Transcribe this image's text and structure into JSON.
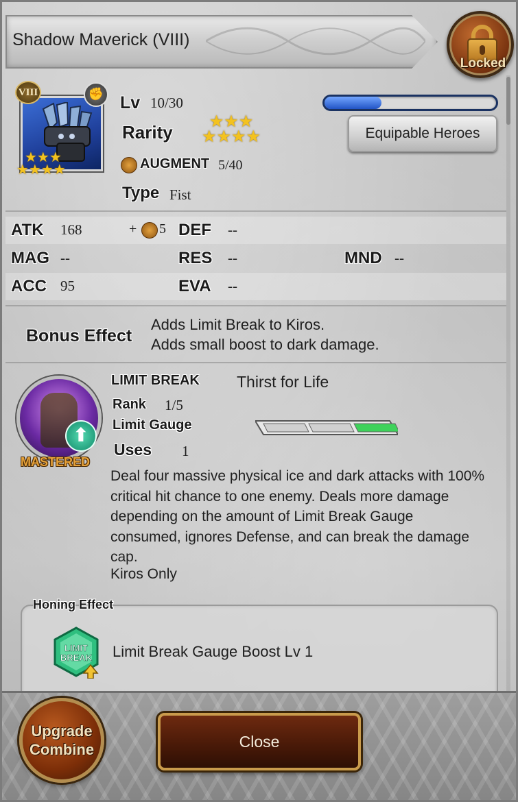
{
  "header": {
    "title": "Shadow Maverick (VIII)"
  },
  "lock": {
    "label": "Locked"
  },
  "item": {
    "series_badge": "VIII",
    "icon_stars": "★★★\n★★★★",
    "level": {
      "label": "Lv",
      "value": "10/30",
      "progress": 0.33
    },
    "rarity": {
      "label": "Rarity",
      "stars_top": "★★★",
      "stars_bottom": "★★★★"
    },
    "equipable_button": "Equipable Heroes",
    "augment": {
      "label": "AUGMENT",
      "value": "5/40"
    },
    "type": {
      "label": "Type",
      "value": "Fist"
    }
  },
  "stats": {
    "atk": {
      "label": "ATK",
      "value": "168",
      "bonus_prefix": "+",
      "bonus": "5"
    },
    "def": {
      "label": "DEF",
      "value": "--"
    },
    "mag": {
      "label": "MAG",
      "value": "--"
    },
    "res": {
      "label": "RES",
      "value": "--"
    },
    "mnd": {
      "label": "MND",
      "value": "--"
    },
    "acc": {
      "label": "ACC",
      "value": "95"
    },
    "eva": {
      "label": "EVA",
      "value": "--"
    }
  },
  "bonus_effect": {
    "label": "Bonus Effect",
    "lines": [
      "Adds Limit Break to Kiros.",
      "Adds small boost to dark damage."
    ]
  },
  "limit_break": {
    "title": "LIMIT BREAK",
    "name": "Thirst for Life",
    "mastered": "MASTERED",
    "rank": {
      "label": "Rank",
      "value": "1/5"
    },
    "gauge": {
      "label": "Limit Gauge",
      "segments_total": 3,
      "segments_active": 1
    },
    "uses": {
      "label": "Uses",
      "value": "1"
    },
    "description_lines": [
      "Deal four massive physical ice and dark attacks with 100%",
      "critical hit chance to one enemy. Deals more damage",
      "depending on the amount of Limit Break Gauge",
      "consumed, ignores Defense, and can break the damage",
      "cap."
    ],
    "restriction": "Kiros Only"
  },
  "honing": {
    "label": "Honing Effect",
    "icon_text_1": "LIMIT",
    "icon_text_2": "BREAK",
    "effect": "Limit Break Gauge Boost Lv 1"
  },
  "footer": {
    "upgrade_line1": "Upgrade",
    "upgrade_line2": "Combine",
    "close": "Close"
  },
  "colors": {
    "gold_star": "#f3c21f",
    "gauge_active": "#3ed25b",
    "lv_bar": "#2254c5",
    "button_brown": "#5a1f09",
    "mastered": "#e6a23a"
  },
  "icons": {
    "lock": "lock-icon",
    "augment": "augment-hammer-icon",
    "fist_type": "fist-icon",
    "honing_badge": "limit-break-badge-icon"
  }
}
